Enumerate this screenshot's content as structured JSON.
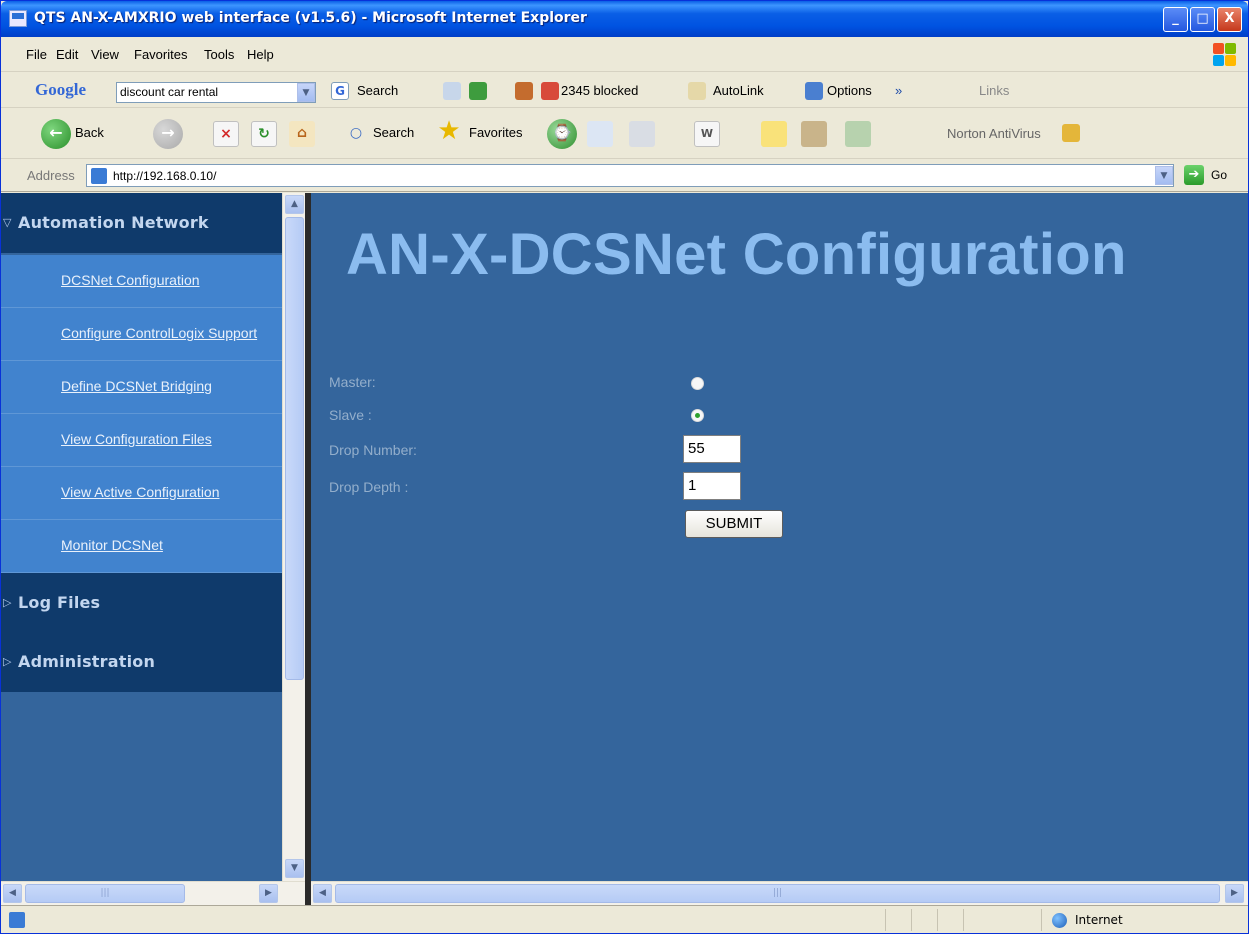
{
  "window": {
    "title": "QTS AN-X-AMXRIO web interface (v1.5.6) - Microsoft Internet Explorer",
    "controls": {
      "minimize": "_",
      "maximize": "□",
      "close": "X"
    }
  },
  "menubar": {
    "items": [
      {
        "label": "File"
      },
      {
        "label": "Edit"
      },
      {
        "label": "View"
      },
      {
        "label": "Favorites"
      },
      {
        "label": "Tools"
      },
      {
        "label": "Help"
      }
    ]
  },
  "google_toolbar": {
    "logo": "Google",
    "query": "discount car rental",
    "search_label": "Search",
    "blocked_label": "2345 blocked",
    "autolink_label": "AutoLink",
    "options_label": "Options",
    "more": "»",
    "links_label": "Links"
  },
  "std_toolbar": {
    "back_label": "Back",
    "search_label": "Search",
    "favorites_label": "Favorites",
    "norton_label": "Norton AntiVirus"
  },
  "address_bar": {
    "label": "Address",
    "url": "http://192.168.0.10/",
    "go_label": "Go"
  },
  "sidebar": {
    "sections": [
      {
        "label": "Automation Network",
        "expanded": true
      },
      {
        "label": "Log Files",
        "expanded": false
      },
      {
        "label": "Administration",
        "expanded": false
      }
    ],
    "items": [
      {
        "label": "DCSNet Configuration"
      },
      {
        "label": "Configure ControlLogix Support"
      },
      {
        "label": "Define DCSNet Bridging"
      },
      {
        "label": "View Configuration Files"
      },
      {
        "label": "View Active Configuration"
      },
      {
        "label": "Monitor DCSNet"
      }
    ]
  },
  "main": {
    "title": "AN-X-DCSNet Configuration",
    "form": {
      "master_label": "Master:",
      "slave_label": "Slave :",
      "selected_mode": "Slave",
      "drop_number_label": "Drop Number:",
      "drop_number_value": "55",
      "drop_depth_label": "Drop Depth :",
      "drop_depth_value": "1",
      "submit_label": "SUBMIT"
    }
  },
  "statusbar": {
    "zone": "Internet"
  },
  "colors": {
    "frame_bg": "#34659c",
    "nav_header_bg": "#0f3a6b",
    "nav_item_bg": "#4183ce",
    "title_text": "#8bbcef",
    "form_label": "#93aecb"
  }
}
